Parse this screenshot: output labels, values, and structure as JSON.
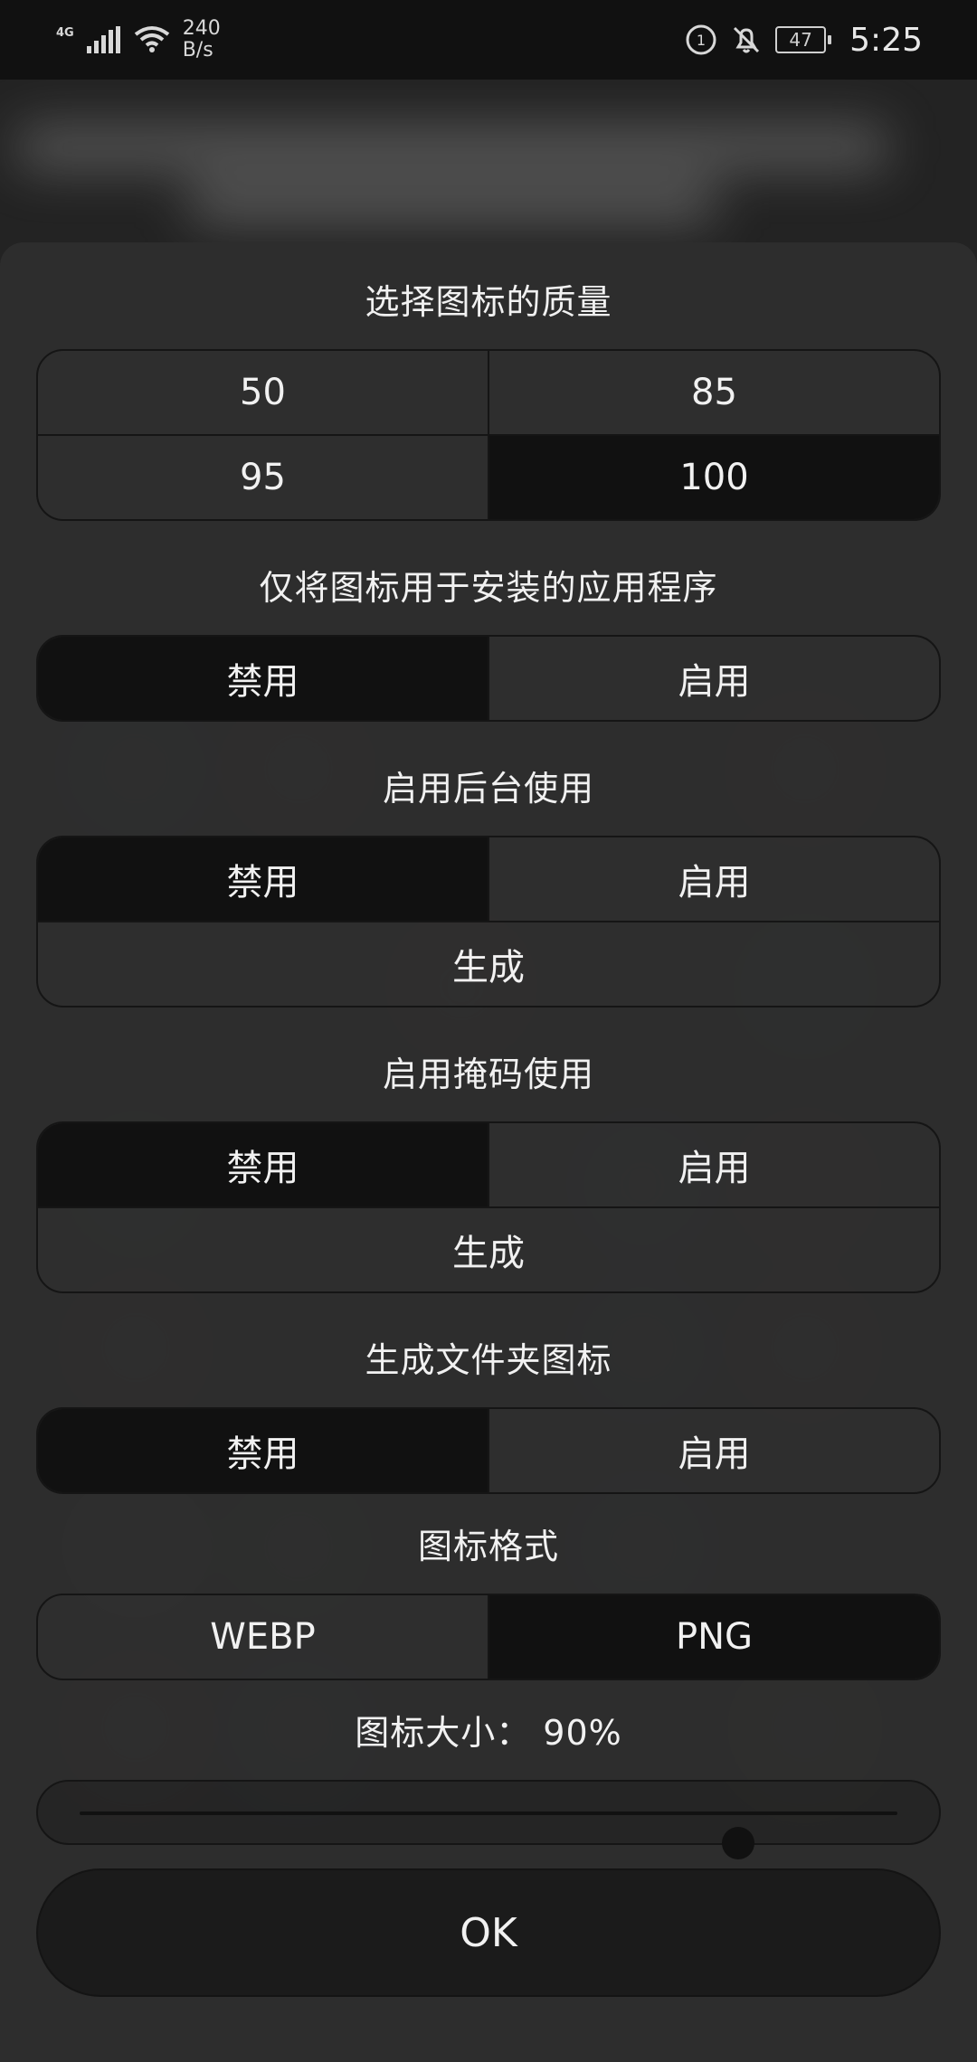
{
  "statusbar": {
    "network": "4G",
    "speed_value": "240",
    "speed_unit": "B/s",
    "battery": "47",
    "time": "5:25",
    "icons": [
      "signal-icon",
      "wifi-icon",
      "data-saver-icon",
      "bell-off-icon",
      "battery-icon"
    ]
  },
  "dialog": {
    "quality": {
      "title": "选择图标的质量",
      "options": [
        "50",
        "85",
        "95",
        "100"
      ],
      "selected": "100"
    },
    "installed_only": {
      "title": "仅将图标用于安装的应用程序",
      "options": [
        "禁用",
        "启用"
      ],
      "selected": "禁用"
    },
    "background": {
      "title": "启用后台使用",
      "options": [
        "禁用",
        "启用"
      ],
      "selected": "禁用",
      "generate_label": "生成"
    },
    "mask": {
      "title": "启用掩码使用",
      "options": [
        "禁用",
        "启用"
      ],
      "selected": "禁用",
      "generate_label": "生成"
    },
    "folder_icon": {
      "title": "生成文件夹图标",
      "options": [
        "禁用",
        "启用"
      ],
      "selected": "禁用"
    },
    "format": {
      "title": "图标格式",
      "options": [
        "WEBP",
        "PNG"
      ],
      "selected": "PNG"
    },
    "size": {
      "title": "图标大小： 90%",
      "value_percent": 90,
      "slider_fraction": 0.805
    },
    "ok_label": "OK"
  }
}
